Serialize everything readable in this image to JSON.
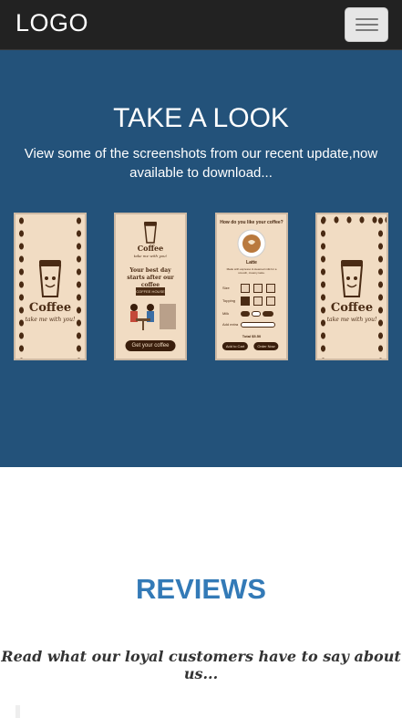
{
  "navbar": {
    "logo": "LOGO",
    "toggle_icon": "hamburger-icon"
  },
  "look": {
    "title": "TAKE A LOOK",
    "subtitle": "View some of the screenshots from our recent update,now available to download...",
    "bg_color": "#23527a",
    "shots": [
      {
        "brand": "Coffee",
        "tagline": "take me with you!"
      },
      {
        "brand": "Coffee",
        "tagline": "take me with you!",
        "headline": "Your best day starts after our coffee",
        "shop": "COFFEE HOUSE",
        "cta": "Get your coffee"
      },
      {
        "question": "How do you like your coffee?",
        "item": "Latte",
        "desc": "Made with espresso & steamed milk for a smooth, creamy taste.",
        "size_label": "Size",
        "topping_label": "Topping",
        "milk_label": "Milk",
        "extra_label": "Add extra",
        "total": "Total $5.50",
        "add_btn": "Add to Cart",
        "order_btn": "Order Now"
      },
      {
        "brand": "Coffee",
        "tagline": "take me with you!"
      }
    ]
  },
  "reviews": {
    "title": "REVIEWS",
    "subtitle": "Read what our loyal customers have to say about us...",
    "title_color": "#337ab7"
  }
}
